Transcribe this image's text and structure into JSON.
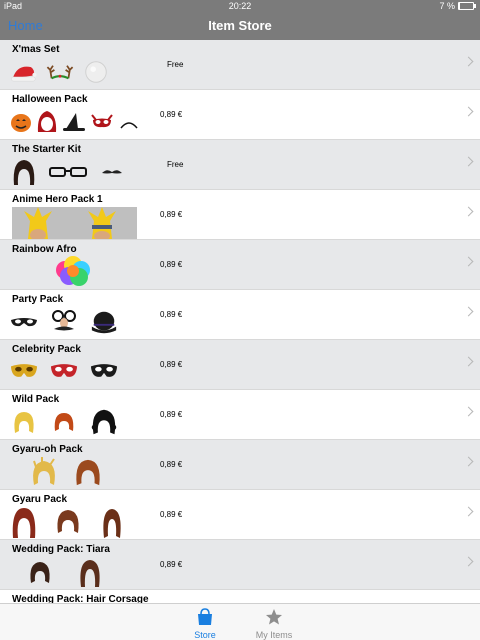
{
  "status": {
    "device": "iPad",
    "time": "20:22",
    "battery": "7 %"
  },
  "nav": {
    "back_label": "Home",
    "title": "Item Store"
  },
  "items": [
    {
      "name": "X'mas Set",
      "price": "Free"
    },
    {
      "name": "Halloween Pack",
      "price": "0,89 €"
    },
    {
      "name": "The Starter Kit",
      "price": "Free"
    },
    {
      "name": "Anime Hero Pack 1",
      "price": "0,89 €"
    },
    {
      "name": "Rainbow Afro",
      "price": "0,89 €"
    },
    {
      "name": "Party Pack",
      "price": "0,89 €"
    },
    {
      "name": "Celebrity Pack",
      "price": "0,89 €"
    },
    {
      "name": "Wild Pack",
      "price": "0,89 €"
    },
    {
      "name": "Gyaru-oh Pack",
      "price": "0,89 €"
    },
    {
      "name": "Gyaru Pack",
      "price": "0,89 €"
    },
    {
      "name": "Wedding Pack: Tiara",
      "price": "0,89 €"
    },
    {
      "name": "Wedding Pack: Hair Corsage",
      "price": ""
    }
  ],
  "tabs": [
    {
      "label": "Store",
      "icon": "shopping-bag-icon",
      "active": true
    },
    {
      "label": "My Items",
      "icon": "star-icon",
      "active": false
    }
  ],
  "colors": {
    "accent": "#1a7fe0",
    "bar": "#7b7b7b",
    "row_alt": "#e7e8ea"
  }
}
